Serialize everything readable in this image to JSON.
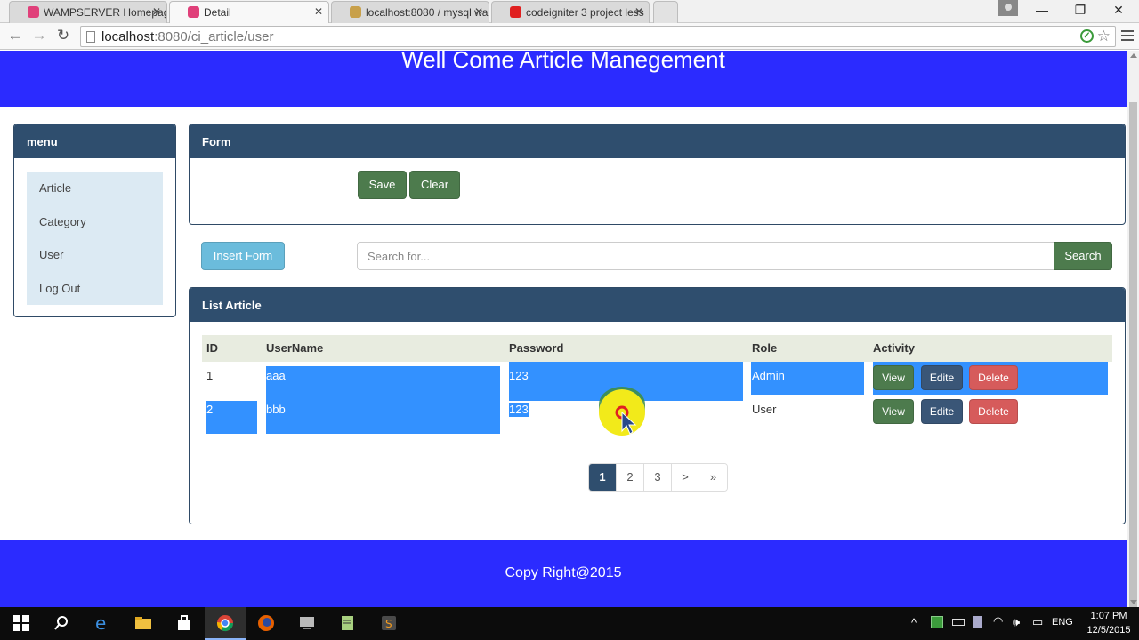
{
  "browser": {
    "tabs": [
      {
        "title": "WAMPSERVER Homepage",
        "active": false
      },
      {
        "title": "Detail",
        "active": true
      },
      {
        "title": "localhost:8080 / mysql wa",
        "active": false
      },
      {
        "title": "codeigniter 3 project less",
        "active": false
      }
    ],
    "url_host": "localhost",
    "url_rest": ":8080/ci_article/user"
  },
  "page": {
    "header_title": "Well Come Article Manegement",
    "menu": {
      "heading": "menu",
      "items": [
        "Article",
        "Category",
        "User",
        "Log Out"
      ]
    },
    "form_panel": {
      "heading": "Form",
      "save_label": "Save",
      "clear_label": "Clear"
    },
    "toolbar": {
      "insert_label": "Insert Form",
      "search_placeholder": "Search for...",
      "search_label": "Search"
    },
    "list_panel": {
      "heading": "List Article",
      "columns": [
        "ID",
        "UserName",
        "Password",
        "Role",
        "Activity"
      ],
      "rows": [
        {
          "id": "1",
          "username": "aaa",
          "password": "123",
          "role": "Admin"
        },
        {
          "id": "2",
          "username": "bbb",
          "password": "123",
          "role": "User"
        }
      ],
      "actions": {
        "view": "View",
        "edit": "Edite",
        "delete": "Delete"
      },
      "pagination": [
        "1",
        "2",
        "3",
        ">",
        "»"
      ],
      "active_page": "1"
    },
    "footer_text": "Copy Right@2015"
  },
  "taskbar": {
    "language": "ENG",
    "time": "1:07 PM",
    "date": "12/5/2015"
  },
  "colors": {
    "banner": "#2b2bff",
    "panel_heading": "#2f4e6e",
    "selection": "#3391ff",
    "success": "#4d7b4d",
    "danger": "#d65b5b",
    "info": "#6bbcdc"
  }
}
